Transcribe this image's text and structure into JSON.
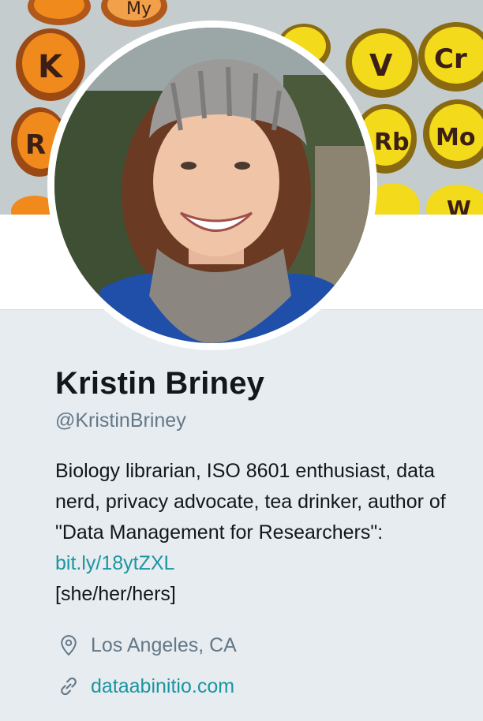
{
  "profile": {
    "name": "Kristin Briney",
    "handle": "@KristinBriney",
    "bio": {
      "text_before_link": "Biology librarian, ISO 8601 enthusiast, data nerd, privacy advocate, tea drinker, author of \"Data Management for Researchers\": ",
      "link": "bit.ly/18ytZXL",
      "text_after_link": "[she/her/hers]"
    },
    "location": "Los Angeles, CA",
    "website": "dataabinitio.com"
  },
  "icons": {
    "location": "map-pin-icon",
    "website": "link-icon"
  },
  "banner": {
    "cupcake_letters": [
      "K",
      "My",
      "R",
      "V",
      "Cr",
      "Mo",
      "Rb",
      "W"
    ]
  },
  "colors": {
    "link": "#1b95a0",
    "secondary_text": "#657786",
    "primary_text": "#14171a",
    "page_background": "#e6ecf0",
    "card_background": "#ffffff",
    "cupcake_orange": "#f08a1c",
    "cupcake_yellow": "#f3da1a"
  }
}
